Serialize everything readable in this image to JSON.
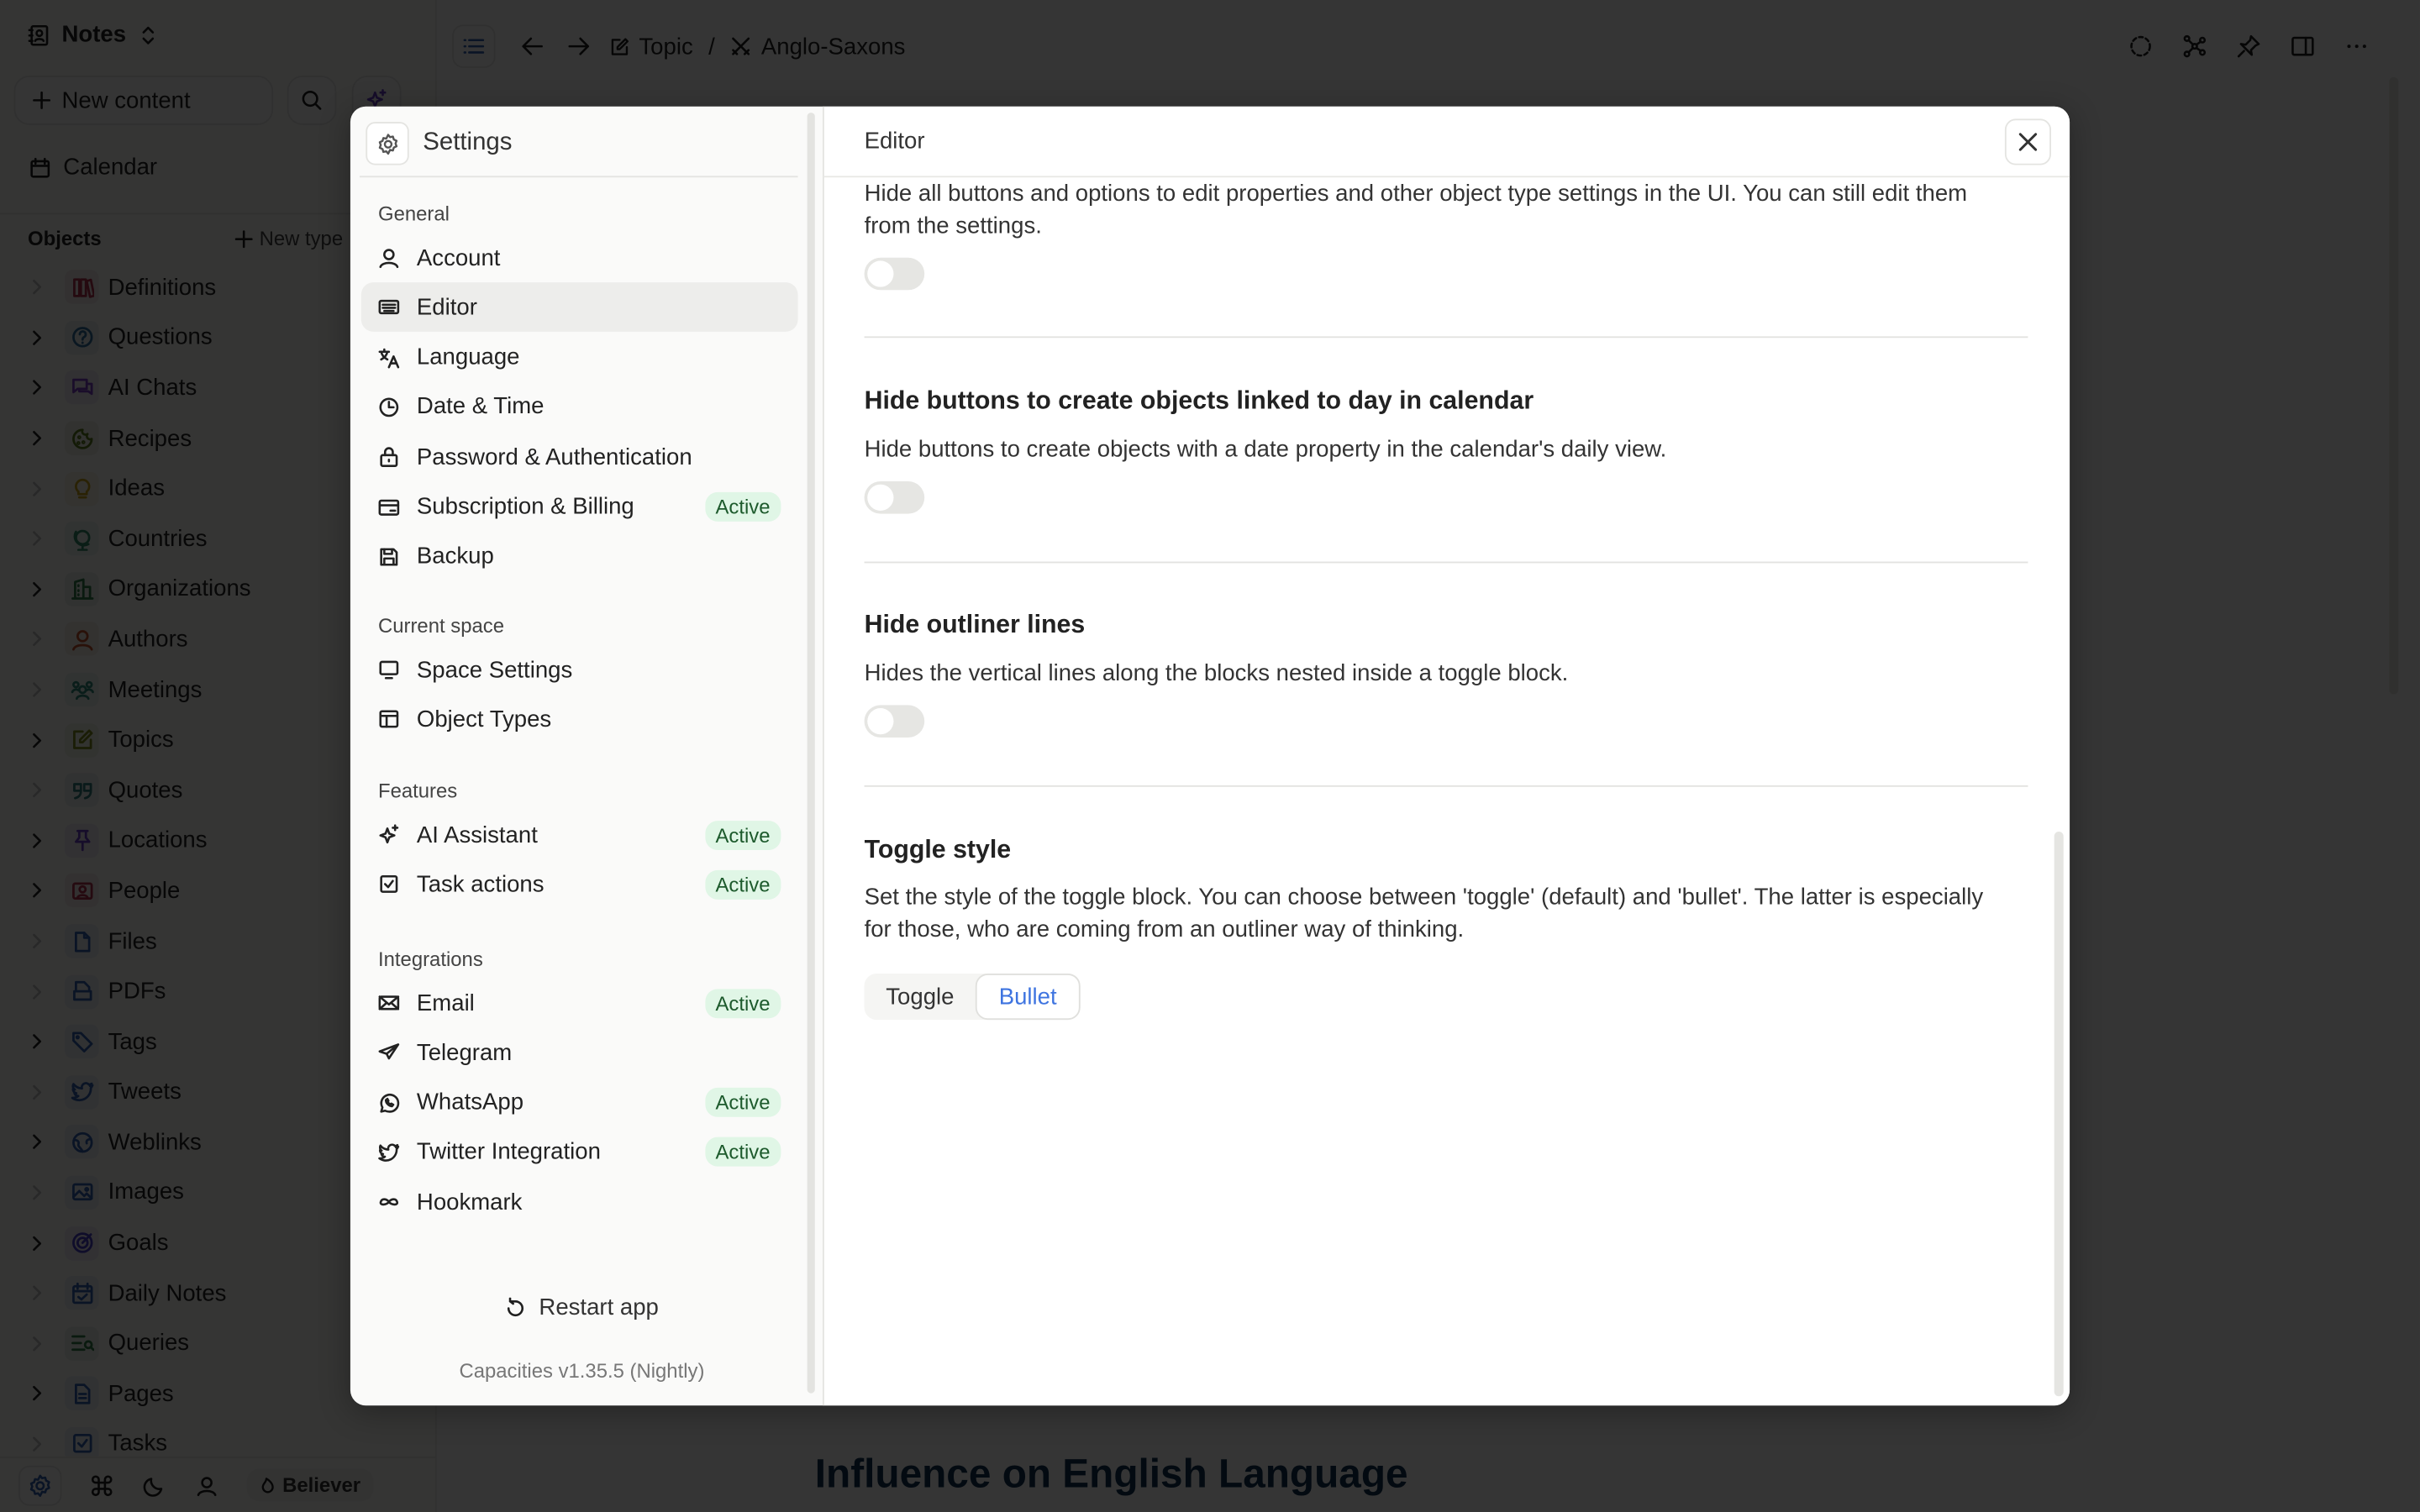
{
  "sidebar": {
    "space_name": "Notes",
    "new_content_label": "New content",
    "calendar_label": "Calendar",
    "objects_heading": "Objects",
    "new_type_label": "New type",
    "object_types": [
      {
        "label": "Definitions",
        "icon": "books-icon",
        "color": "#b0334e",
        "expandable": false
      },
      {
        "label": "Questions",
        "icon": "question-circle-icon",
        "color": "#2f6f9e",
        "expandable": true
      },
      {
        "label": "AI Chats",
        "icon": "chat-bubbles-icon",
        "color": "#7a3fc6",
        "expandable": true
      },
      {
        "label": "Recipes",
        "icon": "cookie-icon",
        "color": "#5d7a1e",
        "expandable": true
      },
      {
        "label": "Ideas",
        "icon": "lightbulb-icon",
        "color": "#c8a21a",
        "expandable": false
      },
      {
        "label": "Countries",
        "icon": "globe-icon",
        "color": "#2f8a6a",
        "expandable": false
      },
      {
        "label": "Organizations",
        "icon": "building-icon",
        "color": "#2f7a4a",
        "expandable": true
      },
      {
        "label": "Authors",
        "icon": "person-icon",
        "color": "#c0502a",
        "expandable": false
      },
      {
        "label": "Meetings",
        "icon": "group-icon",
        "color": "#2f8a7a",
        "expandable": false
      },
      {
        "label": "Topics",
        "icon": "edit-icon",
        "color": "#7a8a1e",
        "expandable": true
      },
      {
        "label": "Quotes",
        "icon": "quote-icon",
        "color": "#2f7a7a",
        "expandable": false
      },
      {
        "label": "Locations",
        "icon": "pin-icon",
        "color": "#6a3fc6",
        "expandable": true
      },
      {
        "label": "People",
        "icon": "contact-icon",
        "color": "#b0334e",
        "expandable": true
      },
      {
        "label": "Files",
        "icon": "file-icon",
        "color": "#2f5fb0",
        "expandable": false
      },
      {
        "label": "PDFs",
        "icon": "pdf-icon",
        "color": "#2f5fb0",
        "expandable": false
      },
      {
        "label": "Tags",
        "icon": "tag-icon",
        "color": "#2f5fb0",
        "expandable": true
      },
      {
        "label": "Tweets",
        "icon": "twitter-icon",
        "color": "#2f5fb0",
        "expandable": false
      },
      {
        "label": "Weblinks",
        "icon": "web-globe-icon",
        "color": "#2f5fb0",
        "expandable": true
      },
      {
        "label": "Images",
        "icon": "image-icon",
        "color": "#2f5fb0",
        "expandable": false
      },
      {
        "label": "Goals",
        "icon": "target-icon",
        "color": "#4a3fc6",
        "expandable": true
      },
      {
        "label": "Daily Notes",
        "icon": "calendar-check-icon",
        "color": "#2f5fb0",
        "expandable": false
      },
      {
        "label": "Queries",
        "icon": "query-icon",
        "color": "#2f7a4a",
        "expandable": false
      },
      {
        "label": "Pages",
        "icon": "page-icon",
        "color": "#2f5fb0",
        "expandable": true
      },
      {
        "label": "Tasks",
        "icon": "task-icon",
        "color": "#2f5fb0",
        "expandable": false
      }
    ],
    "bottom_badge": "Believer"
  },
  "main": {
    "breadcrumb": [
      {
        "label": "Topic",
        "icon": "edit-icon"
      },
      {
        "label": "Anglo-Saxons",
        "icon": "swords-icon"
      }
    ],
    "breadcrumb_separator": "/",
    "visible_heading": "Influence on English Language"
  },
  "settings": {
    "title": "Settings",
    "sections": [
      {
        "label": "General",
        "items": [
          {
            "label": "Account",
            "icon": "user-icon",
            "badge": null,
            "selected": false
          },
          {
            "label": "Editor",
            "icon": "keyboard-icon",
            "badge": null,
            "selected": true
          },
          {
            "label": "Language",
            "icon": "translate-icon",
            "badge": null,
            "selected": false
          },
          {
            "label": "Date & Time",
            "icon": "clock-icon",
            "badge": null,
            "selected": false
          },
          {
            "label": "Password & Authentication",
            "icon": "lock-icon",
            "badge": null,
            "selected": false
          },
          {
            "label": "Subscription & Billing",
            "icon": "credit-card-icon",
            "badge": "Active",
            "selected": false
          },
          {
            "label": "Backup",
            "icon": "save-icon",
            "badge": null,
            "selected": false
          }
        ]
      },
      {
        "label": "Current space",
        "items": [
          {
            "label": "Space Settings",
            "icon": "monitor-icon",
            "badge": null,
            "selected": false
          },
          {
            "label": "Object Types",
            "icon": "layout-icon",
            "badge": null,
            "selected": false
          }
        ]
      },
      {
        "label": "Features",
        "items": [
          {
            "label": "AI Assistant",
            "icon": "sparkle-icon",
            "badge": "Active",
            "selected": false
          },
          {
            "label": "Task actions",
            "icon": "checkbox-icon",
            "badge": "Active",
            "selected": false
          }
        ]
      },
      {
        "label": "Integrations",
        "items": [
          {
            "label": "Email",
            "icon": "mail-icon",
            "badge": "Active",
            "selected": false
          },
          {
            "label": "Telegram",
            "icon": "send-icon",
            "badge": null,
            "selected": false
          },
          {
            "label": "WhatsApp",
            "icon": "whatsapp-icon",
            "badge": "Active",
            "selected": false
          },
          {
            "label": "Twitter Integration",
            "icon": "twitter-icon",
            "badge": "Active",
            "selected": false
          },
          {
            "label": "Hookmark",
            "icon": "infinity-icon",
            "badge": null,
            "selected": false
          }
        ]
      }
    ],
    "restart_label": "Restart app",
    "version": "Capacities v1.35.5 (Nightly)"
  },
  "editor_panel": {
    "title": "Editor",
    "options": [
      {
        "heading": null,
        "description": "Hide all buttons and options to edit properties and other object type settings in the UI. You can still edit them from the settings.",
        "enabled": false
      },
      {
        "heading": "Hide buttons to create objects linked to day in calendar",
        "description": "Hide buttons to create objects with a date property in the calendar's daily view.",
        "enabled": false
      },
      {
        "heading": "Hide outliner lines",
        "description": "Hides the vertical lines along the blocks nested inside a toggle block.",
        "enabled": false
      }
    ],
    "toggle_style": {
      "heading": "Toggle style",
      "description": "Set the style of the toggle block. You can choose between 'toggle' (default) and 'bullet'. The latter is especially for those, who are coming from an outliner way of thinking.",
      "options": [
        "Toggle",
        "Bullet"
      ],
      "selected": "Bullet"
    }
  },
  "colors": {
    "accent": "#3e74e0",
    "active_badge_bg": "#e0f6e6",
    "active_badge_text": "#1d5a2c"
  }
}
